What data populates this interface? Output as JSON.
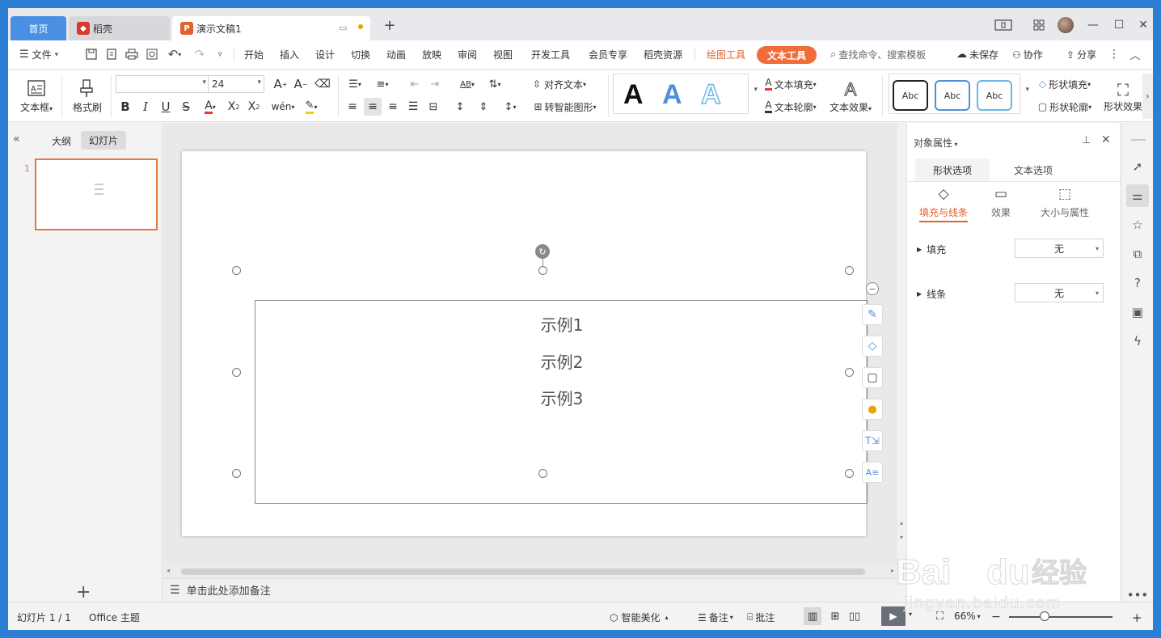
{
  "titlebar": {
    "tab_home": "首页",
    "tab_daoke": "稻壳",
    "tab_doc": "演示文稿1",
    "add_tab": "+"
  },
  "menubar": {
    "file": "文件",
    "items": [
      "开始",
      "插入",
      "设计",
      "切换",
      "动画",
      "放映",
      "审阅",
      "视图",
      "开发工具",
      "会员专享",
      "稻壳资源"
    ],
    "drawing_tools": "绘图工具",
    "text_tools": "文本工具",
    "search_placeholder": "查找命令、搜索模板",
    "unsaved": "未保存",
    "collab": "协作",
    "share": "分享"
  },
  "ribbon": {
    "textbox": "文本框",
    "format_painter": "格式刷",
    "font_name": "",
    "font_size": "24",
    "align_text": "对齐文本",
    "smart_shape": "转智能图形",
    "text_fill": "文本填充",
    "text_outline": "文本轮廓",
    "text_effect": "文本效果",
    "shape_fill": "形状填充",
    "shape_outline": "形状轮廓",
    "shape_effect": "形状效果",
    "abc_label": "Abc",
    "wordart_letter": "A"
  },
  "leftpane": {
    "tab_outline": "大纲",
    "tab_slides": "幻灯片",
    "slide_number": "1",
    "add": "+"
  },
  "slide": {
    "lines": [
      "示例1",
      "示例2",
      "示例3"
    ]
  },
  "notes": {
    "placeholder": "单击此处添加备注"
  },
  "rightpane": {
    "title": "对象属性",
    "tab_shape": "形状选项",
    "tab_text": "文本选项",
    "sub_fill_line": "填充与线条",
    "sub_effect": "效果",
    "sub_size": "大小与属性",
    "fill_label": "填充",
    "fill_value": "无",
    "line_label": "线条",
    "line_value": "无"
  },
  "statusbar": {
    "slide_count": "幻灯片 1 / 1",
    "theme": "Office 主题",
    "smart_beautify": "智能美化",
    "notes": "备注",
    "comment": "批注",
    "zoom": "66%"
  },
  "colors": {
    "accent": "#e0622e",
    "home_tab": "#4a90e2"
  }
}
